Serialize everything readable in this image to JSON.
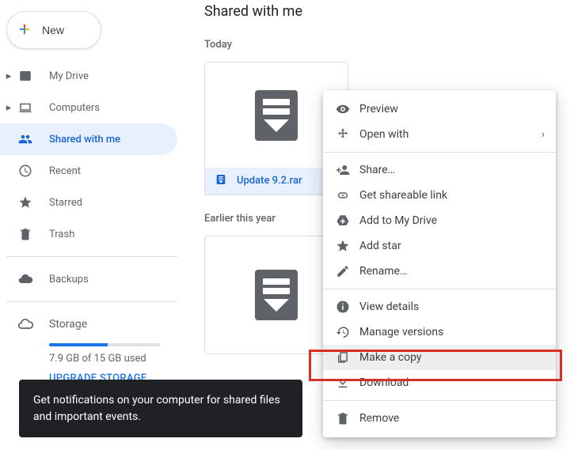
{
  "new_button_label": "New",
  "sidebar": {
    "items": [
      {
        "label": "My Drive"
      },
      {
        "label": "Computers"
      },
      {
        "label": "Shared with me"
      },
      {
        "label": "Recent"
      },
      {
        "label": "Starred"
      },
      {
        "label": "Trash"
      },
      {
        "label": "Backups"
      }
    ],
    "storage": {
      "label": "Storage",
      "used_text": "7.9 GB of 15 GB used",
      "upgrade_label": "UPGRADE STORAGE",
      "fill_percent": 53
    }
  },
  "main": {
    "title": "Shared with me",
    "sections": {
      "today": "Today",
      "earlier": "Earlier this year"
    },
    "selected_file": "Update 9.2.rar"
  },
  "context_menu": {
    "preview": "Preview",
    "open_with": "Open with",
    "share": "Share…",
    "get_link": "Get shareable link",
    "add_to_drive": "Add to My Drive",
    "add_star": "Add star",
    "rename": "Rename…",
    "view_details": "View details",
    "manage_versions": "Manage versions",
    "make_copy": "Make a copy",
    "download": "Download",
    "remove": "Remove"
  },
  "toast": {
    "message": "Get notifications on your computer for shared files and important events."
  }
}
